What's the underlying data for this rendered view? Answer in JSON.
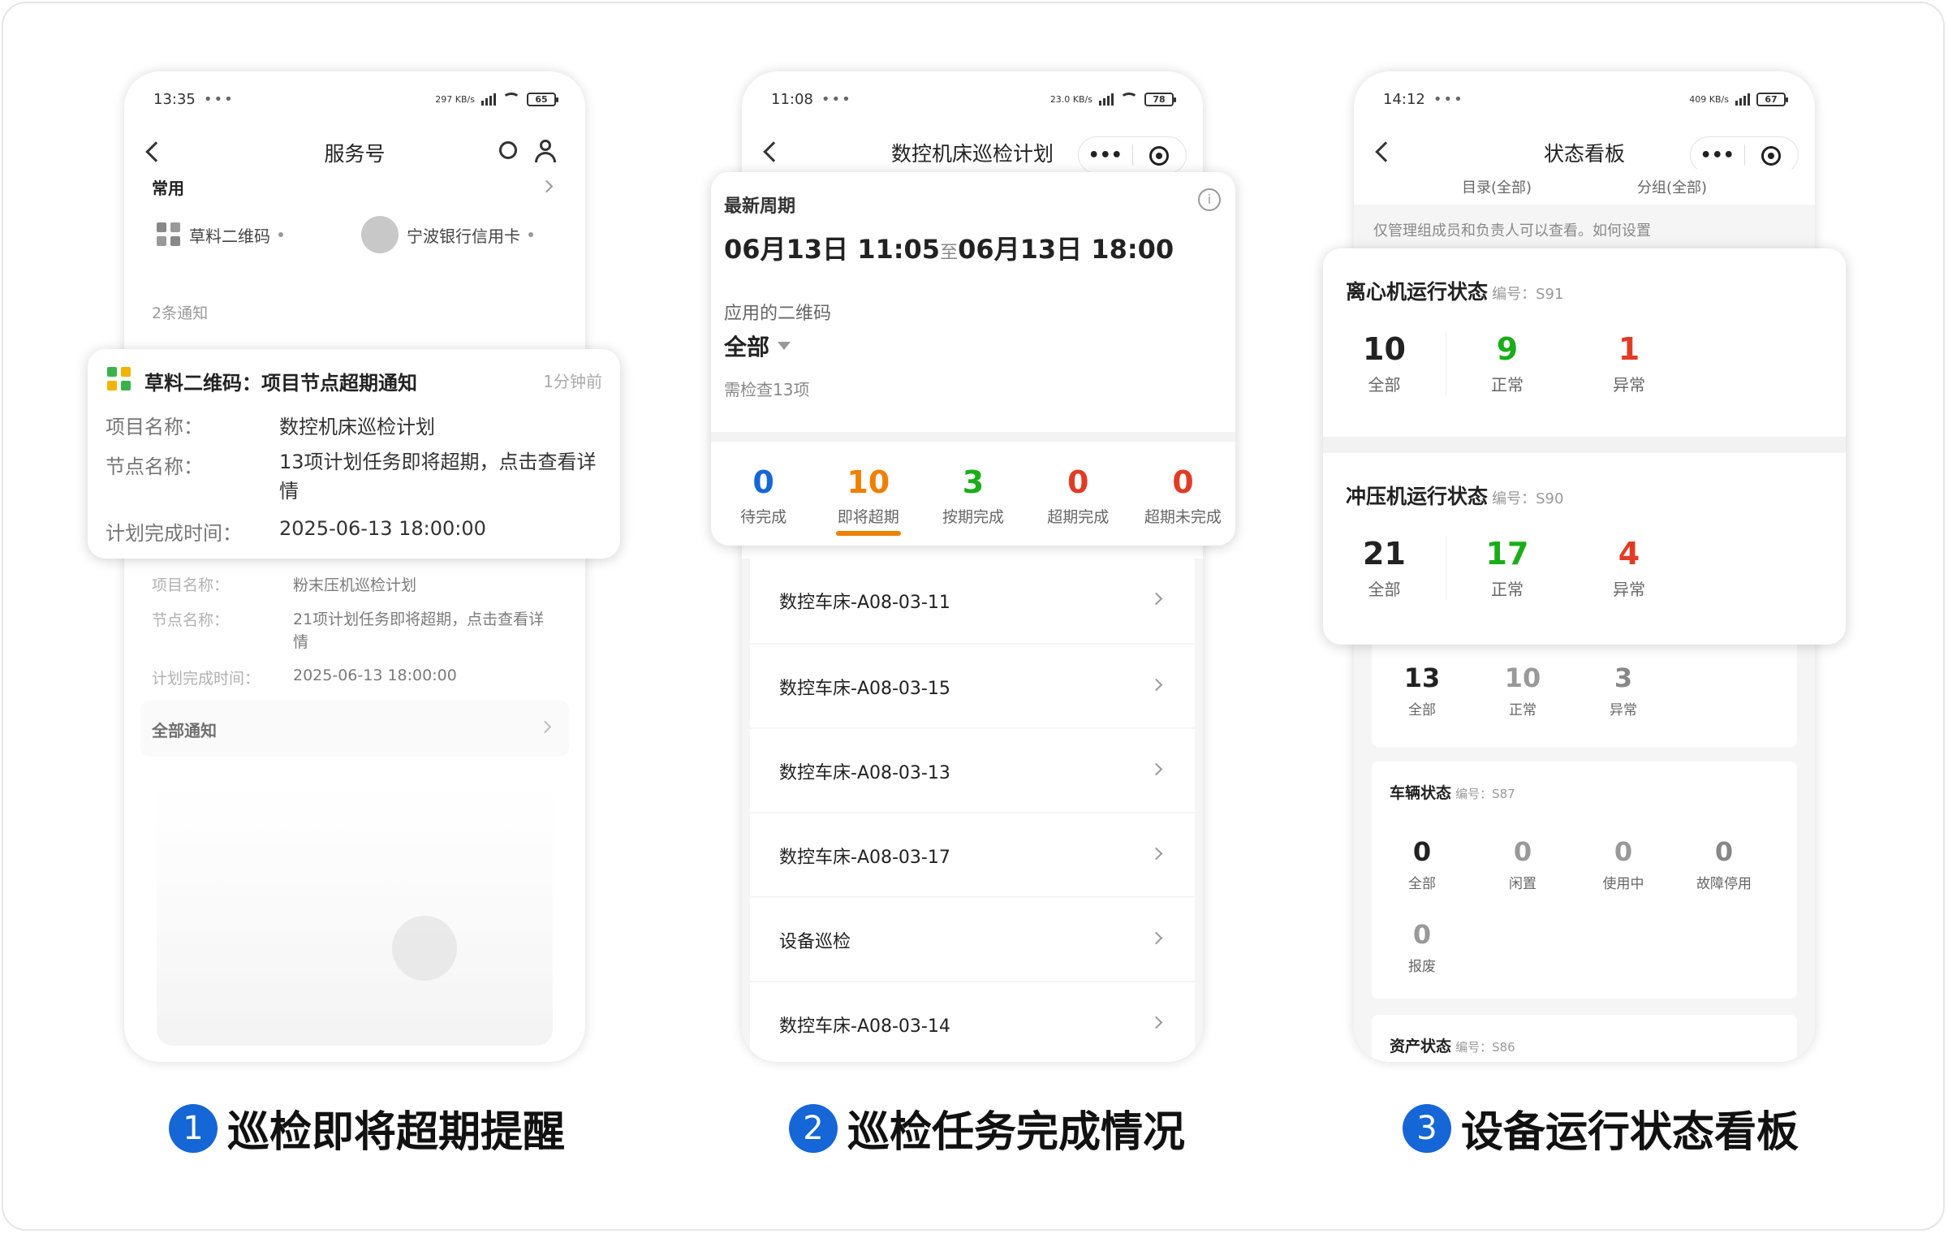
{
  "panel1": {
    "status": {
      "time": "13:35",
      "net": "297 KB/s",
      "battery": "65"
    },
    "nav_title": "服务号",
    "section_common": "常用",
    "shortcuts": [
      "草料二维码",
      "宁波银行信用卡"
    ],
    "notice_count": "2条通知",
    "popup": {
      "title": "草料二维码：项目节点超期通知",
      "time": "1分钟前",
      "rows": [
        {
          "label": "项目名称：",
          "value": "数控机床巡检计划"
        },
        {
          "label": "节点名称：",
          "value": "13项计划任务即将超期，点击查看详情"
        },
        {
          "label": "计划完成时间：",
          "value": "2025-06-13 18:00:00"
        }
      ]
    },
    "second_notice": {
      "rows": [
        {
          "label": "项目名称：",
          "value": "粉末压机巡检计划"
        },
        {
          "label": "节点名称：",
          "value": "21项计划任务即将超期，点击查看详情"
        },
        {
          "label": "计划完成时间：",
          "value": "2025-06-13 18:00:00"
        }
      ]
    },
    "all_notices": "全部通知",
    "caption_num": "1",
    "caption": "巡检即将超期提醒"
  },
  "panel2": {
    "status": {
      "time": "11:08",
      "net": "23.0 KB/s",
      "battery": "78"
    },
    "nav_title": "数控机床巡检计划",
    "card": {
      "cycle_label": "最新周期",
      "cycle_start": "06月13日 11:05",
      "cycle_to": "至",
      "cycle_end": "06月13日 18:00",
      "qr_label": "应用的二维码",
      "qr_value": "全部",
      "check_count": "需检查13项"
    },
    "stats": [
      {
        "value": "0",
        "label": "待完成",
        "color": "#1566d6"
      },
      {
        "value": "10",
        "label": "即将超期",
        "color": "#f08000"
      },
      {
        "value": "3",
        "label": "按期完成",
        "color": "#1aad19"
      },
      {
        "value": "0",
        "label": "超期完成",
        "color": "#e23b25"
      },
      {
        "value": "0",
        "label": "超期未完成",
        "color": "#e23b25"
      }
    ],
    "list": [
      "数控车床-A08-03-11",
      "数控车床-A08-03-15",
      "数控车床-A08-03-13",
      "数控车床-A08-03-17",
      "设备巡检",
      "数控车床-A08-03-14"
    ],
    "caption_num": "2",
    "caption": "巡检任务完成情况"
  },
  "panel3": {
    "status": {
      "time": "14:12",
      "net": "409 KB/s",
      "battery": "67"
    },
    "nav_title": "状态看板",
    "filters": [
      "目录(全部)",
      "分组(全部)"
    ],
    "tip": "仅管理组成员和负责人可以查看。如何设置",
    "card1": {
      "title": "离心机运行状态",
      "code": "编号：S91",
      "stats": [
        {
          "value": "10",
          "label": "全部"
        },
        {
          "value": "9",
          "label": "正常"
        },
        {
          "value": "1",
          "label": "异常"
        }
      ]
    },
    "card2": {
      "title": "冲压机运行状态",
      "code": "编号：S90",
      "stats": [
        {
          "value": "21",
          "label": "全部"
        },
        {
          "value": "17",
          "label": "正常"
        },
        {
          "value": "4",
          "label": "异常"
        }
      ]
    },
    "card3": {
      "stats": [
        {
          "value": "13",
          "label": "全部"
        },
        {
          "value": "10",
          "label": "正常"
        },
        {
          "value": "3",
          "label": "异常"
        }
      ]
    },
    "card4": {
      "title": "车辆状态",
      "code": "编号：S87",
      "stats": [
        {
          "value": "0",
          "label": "全部"
        },
        {
          "value": "0",
          "label": "闲置"
        },
        {
          "value": "0",
          "label": "使用中"
        },
        {
          "value": "0",
          "label": "故障停用"
        },
        {
          "value": "0",
          "label": "报废"
        }
      ]
    },
    "card5": {
      "title": "资产状态",
      "code": "编号：S86"
    },
    "caption_num": "3",
    "caption": "设备运行状态看板"
  },
  "colors": {
    "green": "#1aad19",
    "red": "#e23b25",
    "blue": "#1566d6",
    "orange": "#f08000"
  }
}
